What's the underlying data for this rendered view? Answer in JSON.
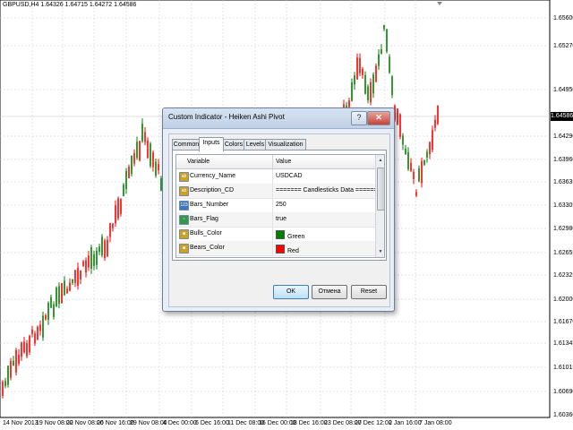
{
  "chart": {
    "symbol_info": "GBPUSD,H4  1.64326 1.64715 1.64272 1.64586",
    "current_price": "1.64586",
    "price_labels": [
      "1.65600",
      "1.65270",
      "1.64950",
      "1.64290",
      "1.63960",
      "1.63635",
      "1.63305",
      "1.62980",
      "1.62655",
      "1.62325",
      "1.62000",
      "1.61670",
      "1.61345",
      "1.61015",
      "1.60690",
      "1.60360"
    ],
    "time_labels": [
      "14 Nov 2013",
      "19 Nov 08:00",
      "22 Nov 08:00",
      "26 Nov 16:00",
      "29 Nov 08:00",
      "4 Dec 00:00",
      "6 Dec 16:00",
      "11 Dec 08:00",
      "16 Dec 00:00",
      "18 Dec 16:00",
      "23 Dec 08:00",
      "27 Dec 12:00",
      "2 Jan 16:00",
      "7 Jan 08:00"
    ],
    "colors": {
      "bull": "#008000",
      "bear": "#ff0000",
      "grid": "#c8c8c8",
      "background": "#ffffff"
    }
  },
  "dialog": {
    "title": "Custom Indicator - Heiken Ashi Pivot",
    "help_label": "?",
    "close_label": "✕",
    "tabs": [
      {
        "label": "Common"
      },
      {
        "label": "Inputs"
      },
      {
        "label": "Colors"
      },
      {
        "label": "Levels"
      },
      {
        "label": "Visualization"
      }
    ],
    "active_tab": "Inputs",
    "grid": {
      "col_variable": "Variable",
      "col_value": "Value",
      "rows": [
        {
          "icon": "abc-string-icon",
          "icon_text": "ab",
          "name": "Currency_Name",
          "value": "USDCAD"
        },
        {
          "icon": "abc-string-icon",
          "icon_text": "ab",
          "name": "Description_CD",
          "value": "======= Candlesticks Data ======="
        },
        {
          "icon": "integer-icon",
          "icon_text": "123",
          "name": "Bars_Number",
          "value": "250"
        },
        {
          "icon": "bool-icon",
          "icon_text": "~",
          "name": "Bars_Flag",
          "value": "true"
        },
        {
          "icon": "color-icon",
          "icon_text": "■",
          "name": "Bulls_Color",
          "value": "Green",
          "swatch": "#008000"
        },
        {
          "icon": "color-icon",
          "icon_text": "■",
          "name": "Bears_Color",
          "value": "Red",
          "swatch": "#ff0000"
        }
      ]
    },
    "buttons": {
      "ok": "OK",
      "cancel": "Отмена",
      "reset": "Reset"
    }
  }
}
